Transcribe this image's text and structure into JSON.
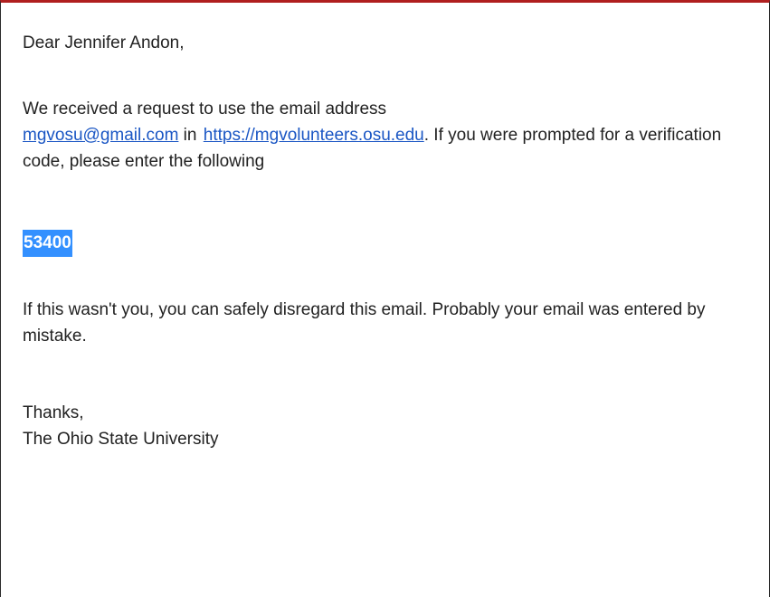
{
  "email": {
    "greeting": "Dear Jennifer Andon,",
    "intro_before_email": "We received a request to use the email address",
    "email_link": "mgvosu@gmail.com",
    "connector": " in ",
    "site_link": "https://mgvolunteers.osu.edu",
    "intro_after_site": ". If you were prompted for a verification code, please enter the following",
    "verification_code": "53400",
    "disregard_note": "If this wasn't you, you can safely disregard this email. Probably your email was entered by mistake.",
    "closing": "Thanks,",
    "signature": "The Ohio State University"
  },
  "colors": {
    "top_border": "#b01f1f",
    "link": "#1a56c4",
    "highlight": "#3390ff"
  }
}
